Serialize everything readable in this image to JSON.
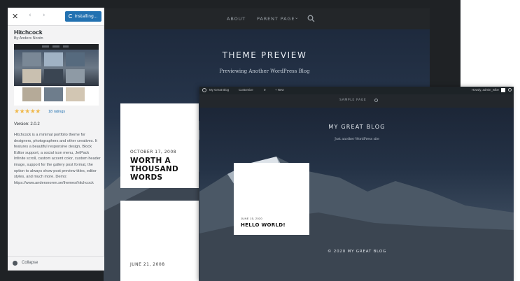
{
  "back_window": {
    "nav": {
      "about": "ABOUT",
      "parent_page": "PARENT PAGE",
      "chevron": "⌄"
    },
    "hero": {
      "title": "THEME PREVIEW",
      "subtitle": "Previewing Another WordPress Blog"
    },
    "posts": [
      {
        "date": "OCTOBER 17, 2008",
        "title": "WORTH A THOUSAND WORDS"
      },
      {
        "date": "JUNE 21, 2008",
        "title": ""
      }
    ]
  },
  "sidebar": {
    "close_icon": "✕",
    "back_icon": "‹",
    "forward_icon": "›",
    "install_button": "Installing...",
    "theme_name": "Hitchcock",
    "author": "By Anders Norén",
    "rating_stars": "★★★★★",
    "rating_value": 4.5,
    "reviews": "18 ratings",
    "version": "Version: 2.0.2",
    "description": "Hitchcock is a minimal portfolio theme for designers, photographers and other creatives. It features a beautiful responsive design, Block Editor support, a social icon menu, JetPack Infinite scroll, custom accent color, custom header image, support for the gallery post format, the option to always show post preview titles, editor styles, and much more. Demo: https://www.andersnoren.se/themes/hitchcock",
    "collapse_label": "Collapse"
  },
  "front_window": {
    "admin_bar": {
      "site_name": "My Great Blog",
      "customize": "Customize",
      "comments": "0",
      "new": "+  New",
      "howdy": "Howdy, admin_wlbe"
    },
    "nav": {
      "sample_page": "SAMPLE PAGE"
    },
    "hero": {
      "title": "MY GREAT BLOG",
      "subtitle": "Just another WordPress site"
    },
    "post": {
      "date": "JUNE 15, 2020",
      "title": "HELLO WORLD!"
    },
    "footer": "© 2020 MY GREAT BLOG"
  },
  "colors": {
    "accent_button": "#2271b1",
    "star": "#f0b849",
    "admin_bar": "#1d2327"
  }
}
